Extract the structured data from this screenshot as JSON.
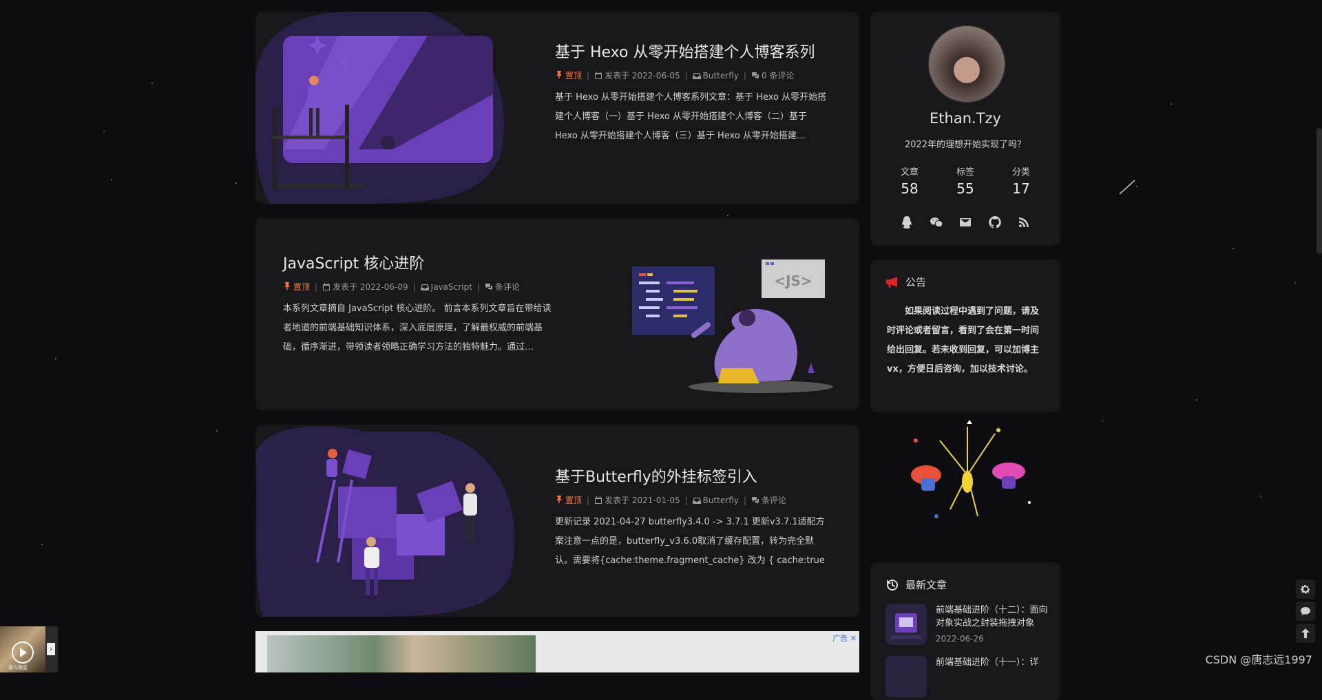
{
  "posts": [
    {
      "title": "基于 Hexo 从零开始搭建个人博客系列",
      "pinned": "置顶",
      "date": "发表于 2022-06-05",
      "category": "Butterfly",
      "comments": "0 条评论",
      "excerpt": "基于 Hexo 从零开始搭建个人博客系列文章：基于 Hexo 从零开始搭建个人博客（一）基于 Hexo 从零开始搭建个人博客（二）基于 Hexo 从零开始搭建个人博客（三）基于 Hexo 从零开始搭建…"
    },
    {
      "title": "JavaScript 核心进阶",
      "pinned": "置顶",
      "date": "发表于 2022-06-09",
      "category": "JavaScript",
      "comments": "条评论",
      "excerpt": "本系列文章摘自 JavaScript 核心进阶。 前言本系列文章旨在带给读者地道的前端基础知识体系，深入底层原理，了解最权威的前端基础，循序渐进，带领读者领略正确学习方法的独特魅力。通过…",
      "js_badge": "<JS>"
    },
    {
      "title": "基于Butterfly的外挂标签引入",
      "pinned": "置顶",
      "date": "发表于 2021-01-05",
      "category": "Butterfly",
      "comments": "条评论",
      "excerpt": "更新记录 2021-04-27 butterfly3.4.0 -> 3.7.1 更新v3.7.1适配方案注意一点的是，butterfly_v3.6.0取消了缓存配置，转为完全默认。需要将{cache:theme.fragment_cache} 改为 { cache:true }…"
    }
  ],
  "ad": {
    "tag": "广告 ✕"
  },
  "author": {
    "name": "Ethan.Tzy",
    "description": "2022年的理想开始实现了吗？",
    "stats": [
      {
        "label": "文章",
        "value": "58"
      },
      {
        "label": "标签",
        "value": "55"
      },
      {
        "label": "分类",
        "value": "17"
      }
    ],
    "socials": [
      "qq-icon",
      "wechat-icon",
      "mail-icon",
      "github-icon",
      "rss-icon"
    ]
  },
  "announcement": {
    "title": "公告",
    "text": "如果阅读过程中遇到了问题，请及时评论或者留言，看到了会在第一时间给出回复。若未收到回复，可以加博主vx，方便日后咨询，加以技术讨论。"
  },
  "recent": {
    "title": "最新文章",
    "items": [
      {
        "title": "前端基础进阶（十二）：面向对象实战之封装拖拽对象",
        "date": "2022-06-26"
      },
      {
        "title": "前端基础进阶（十一）：详",
        "date": ""
      }
    ]
  },
  "player": {
    "label": "唐与晚星"
  },
  "watermark": "CSDN @唐志远1997",
  "colors": {
    "accent": "#ff7242",
    "card_bg": "#18181a",
    "page_bg": "#0d0d0f",
    "purple": "#6a3fb8"
  }
}
